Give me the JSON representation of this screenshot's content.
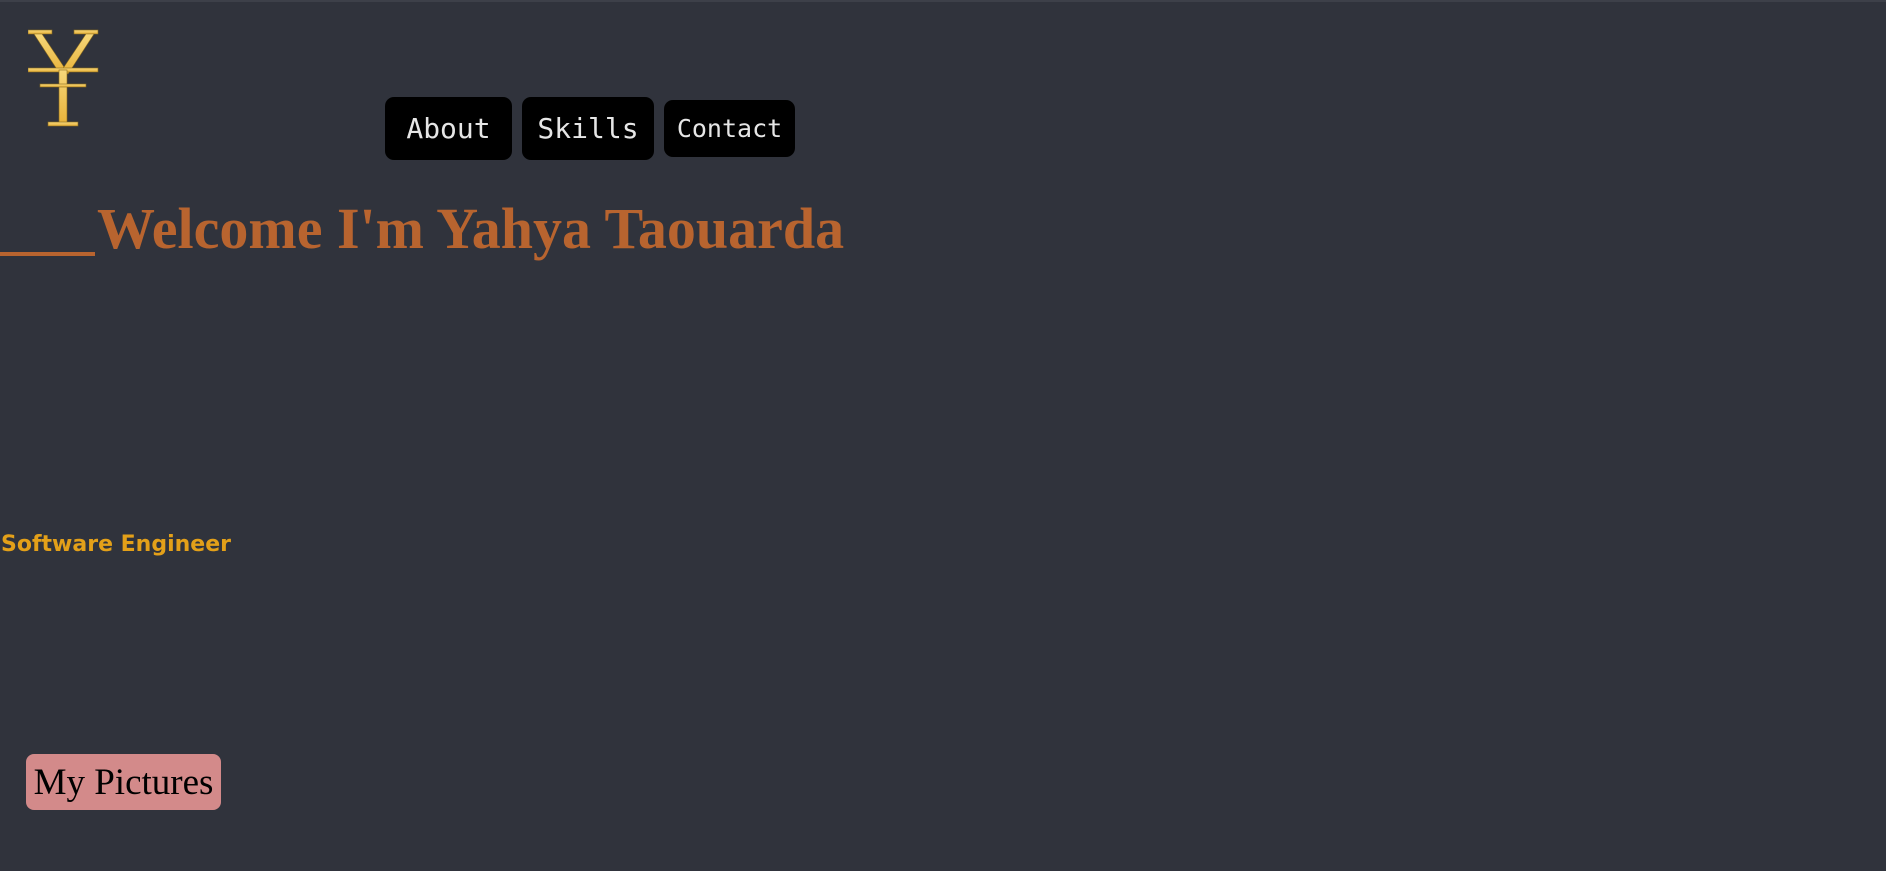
{
  "header": {
    "logo_icon": "yen-symbol-logo-icon",
    "logo_color": "#f2c75c",
    "nav": {
      "about_label": "About",
      "skills_label": "Skills",
      "contact_label": "Contact"
    }
  },
  "hero": {
    "title": "Welcome I'm Yahya Taouarda",
    "subtitle": "Software Engineer"
  },
  "actions": {
    "pictures_label": "My Pictures"
  },
  "colors": {
    "background": "#30333c",
    "title": "#b8642f",
    "subtitle": "#e3a019",
    "nav_button_bg": "#000000",
    "pictures_button_bg": "#d38a8a"
  }
}
